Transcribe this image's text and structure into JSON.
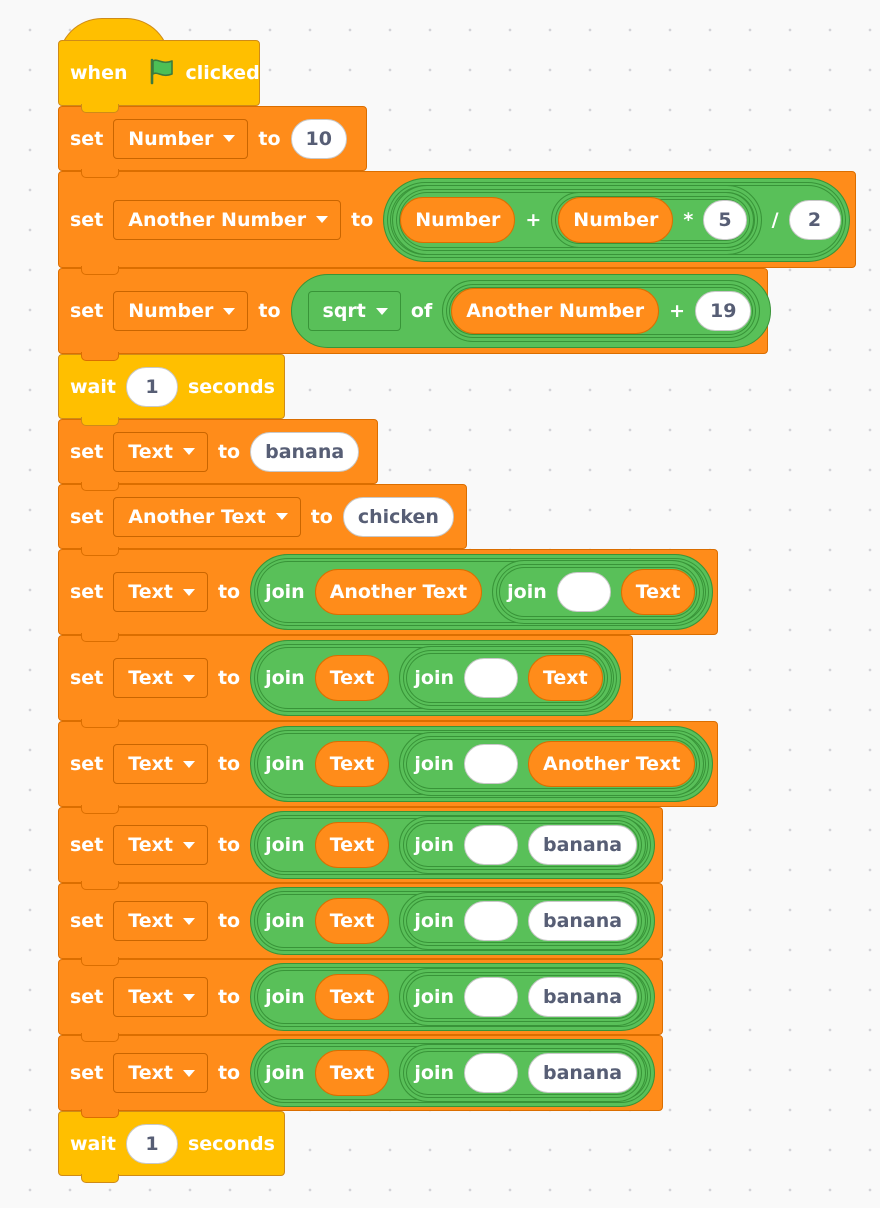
{
  "hat": {
    "when": "when",
    "clicked": "clicked",
    "flag_icon": "green-flag-icon"
  },
  "b1": {
    "set": "set",
    "var": "Number",
    "to": "to",
    "value": "10"
  },
  "b2": {
    "set": "set",
    "var": "Another Number",
    "to": "to",
    "r1": "Number",
    "plus": "+",
    "r2": "Number",
    "times": "*",
    "n5": "5",
    "div": "/",
    "n2": "2"
  },
  "b3": {
    "set": "set",
    "var": "Number",
    "to": "to",
    "fn": "sqrt",
    "of": "of",
    "r1": "Another Number",
    "plus": "+",
    "n19": "19"
  },
  "w1": {
    "wait": "wait",
    "value": "1",
    "seconds": "seconds"
  },
  "b4": {
    "set": "set",
    "var": "Text",
    "to": "to",
    "value": "banana"
  },
  "b5": {
    "set": "set",
    "var": "Another Text",
    "to": "to",
    "value": "chicken"
  },
  "b6": {
    "set": "set",
    "var": "Text",
    "to": "to",
    "join1": "join",
    "r1": "Another Text",
    "join2": "join",
    "empty": "",
    "r2": "Text"
  },
  "b7": {
    "set": "set",
    "var": "Text",
    "to": "to",
    "join1": "join",
    "r1": "Text",
    "join2": "join",
    "empty": "",
    "r2": "Text"
  },
  "b8": {
    "set": "set",
    "var": "Text",
    "to": "to",
    "join1": "join",
    "r1": "Text",
    "join2": "join",
    "empty": "",
    "r2": "Another Text"
  },
  "b9": {
    "set": "set",
    "var": "Text",
    "to": "to",
    "join1": "join",
    "r1": "Text",
    "join2": "join",
    "empty": "",
    "v": "banana"
  },
  "b10": {
    "set": "set",
    "var": "Text",
    "to": "to",
    "join1": "join",
    "r1": "Text",
    "join2": "join",
    "empty": "",
    "v": "banana"
  },
  "b11": {
    "set": "set",
    "var": "Text",
    "to": "to",
    "join1": "join",
    "r1": "Text",
    "join2": "join",
    "empty": "",
    "v": "banana"
  },
  "b12": {
    "set": "set",
    "var": "Text",
    "to": "to",
    "join1": "join",
    "r1": "Text",
    "join2": "join",
    "empty": "",
    "v": "banana"
  },
  "w2": {
    "wait": "wait",
    "value": "1",
    "seconds": "seconds"
  },
  "colors": {
    "variables": "#ff8c1a",
    "operators": "#59c059",
    "control": "#ffbf00",
    "canvas": "#f9f9f9"
  }
}
